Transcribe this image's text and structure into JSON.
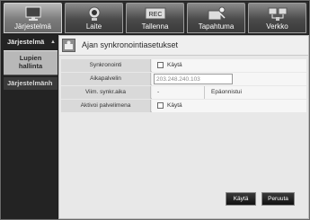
{
  "tabs": [
    {
      "label": "Järjestelmä",
      "icon": "monitor-icon",
      "active": true
    },
    {
      "label": "Laite",
      "icon": "camera-icon",
      "active": false
    },
    {
      "label": "Tallenna",
      "icon": "rec-icon",
      "active": false
    },
    {
      "label": "Tapahtuma",
      "icon": "event-icon",
      "active": false
    },
    {
      "label": "Verkko",
      "icon": "network-icon",
      "active": false
    }
  ],
  "sidebar": {
    "items": [
      {
        "label": "Järjestelmä"
      },
      {
        "label": "Lupien hallinta"
      },
      {
        "label": "Järjestelmänh"
      }
    ]
  },
  "panel": {
    "title": "Ajan synkronointiasetukset"
  },
  "form": {
    "sync_label": "Synkronointi",
    "sync_check_label": "Käytä",
    "server_label": "Aikapalvelin",
    "server_value": "203.248.240.103",
    "last_sync_label": "Viim. synkr.aika",
    "last_sync_value": "-",
    "last_sync_status": "Epäonnistui",
    "activate_label": "Aktivoi palvelimena",
    "activate_check_label": "Käytä"
  },
  "buttons": {
    "apply": "Käytä",
    "cancel": "Peruuta"
  }
}
